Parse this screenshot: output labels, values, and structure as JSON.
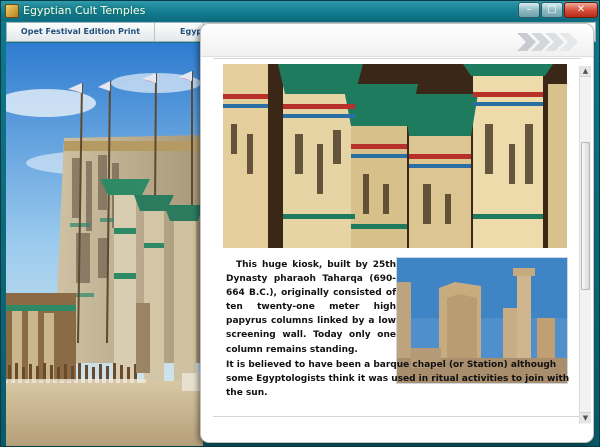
{
  "window": {
    "title": "Egyptian Cult Temples",
    "controls": {
      "minimize": "–",
      "maximize": "□",
      "close": "✕"
    }
  },
  "tabs": [
    {
      "label": "Opet Festival Edition Print"
    },
    {
      "label": "Egyp"
    }
  ],
  "panel": {
    "paragraphs": [
      "This huge kiosk, built by 25th Dynasty pharaoh Taharqa (690-664 B.C.), originally consisted of ten twenty-one meter high papyrus columns linked by a low screening wall. Today only one column remains standing.",
      "It is believed to have been a barque chapel (or Station) although some Egyptologists think it was used in ritual activities to join with the sun."
    ],
    "scrollbar": {
      "up": "▲",
      "down": "▼"
    }
  },
  "icons": {
    "app": "temple-app-icon",
    "nav": "next-chevrons-icon"
  },
  "colors": {
    "titlebar": "#137c90",
    "tab_text": "#1f4f7a",
    "close": "#d8513c"
  }
}
